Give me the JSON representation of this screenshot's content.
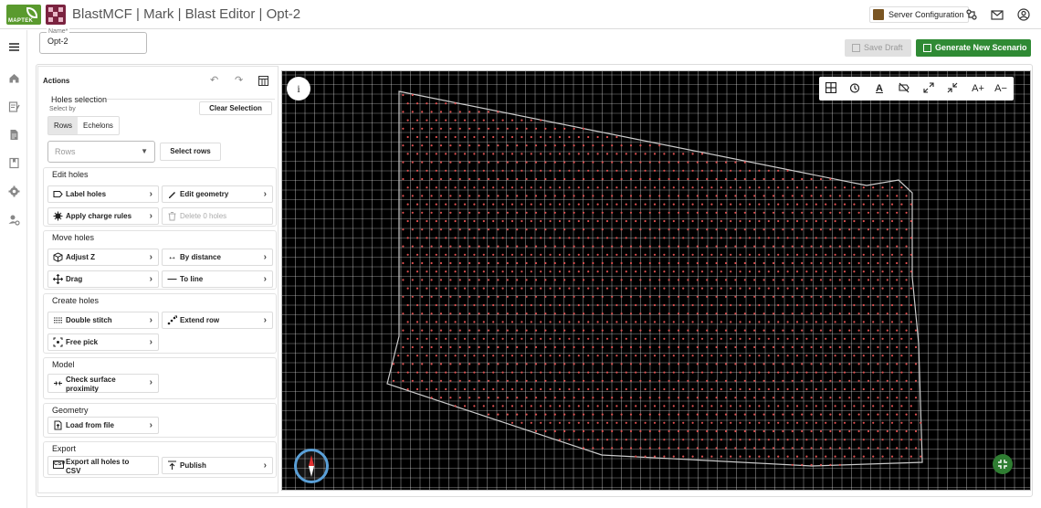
{
  "header": {
    "logo_text": "MAPTEK",
    "title": "BlastMCF | Mark | Blast Editor | Opt-2",
    "server_button": "Server Configuration",
    "icons": [
      "network-icon",
      "mail-icon",
      "account-icon"
    ]
  },
  "leftnav": {
    "icons": [
      "menu-icon",
      "home-icon",
      "edit-note-icon",
      "document-icon",
      "bookmark-icon",
      "settings-icon",
      "user-settings-icon"
    ]
  },
  "name_field": {
    "label": "Name*",
    "value": "Opt-2"
  },
  "toolbar": {
    "save_draft": "Save Draft",
    "generate": "Generate New Scenario"
  },
  "actions": {
    "title": "Actions",
    "holes_selection": {
      "title": "Holes selection",
      "select_by": "Select by",
      "options": [
        "Rows",
        "Echelons"
      ],
      "selected": "Rows",
      "clear": "Clear Selection",
      "dropdown_placeholder": "Rows",
      "select_rows": "Select rows"
    },
    "edit_holes": {
      "title": "Edit holes",
      "label_holes": "Label holes",
      "edit_geometry": "Edit geometry",
      "apply_charge_rules": "Apply charge rules",
      "delete_holes": "Delete 0 holes"
    },
    "move_holes": {
      "title": "Move holes",
      "adjust_z": "Adjust Z",
      "by_distance": "By distance",
      "drag": "Drag",
      "to_line": "To line"
    },
    "create_holes": {
      "title": "Create holes",
      "double_stitch": "Double stitch",
      "extend_row": "Extend row",
      "free_pick": "Free pick"
    },
    "model": {
      "title": "Model",
      "check_surface": "Check surface proximity"
    },
    "geometry": {
      "title": "Geometry",
      "load_from_file": "Load from file"
    },
    "export": {
      "title": "Export",
      "export_all": "Export all holes to CSV",
      "publish": "Publish"
    }
  },
  "map": {
    "toolbar_icons": [
      "grid-icon",
      "timing-icon",
      "text-color-icon",
      "hide-labels-icon",
      "expand-icon",
      "collapse-icon",
      "font-increase-icon",
      "font-decrease-icon"
    ],
    "font_increase": "A+",
    "font_decrease": "A−",
    "info": "i",
    "colors": {
      "background": "#000000",
      "grid": "#ffffff",
      "holes": "#e05050",
      "outline": "#cccccc"
    }
  }
}
